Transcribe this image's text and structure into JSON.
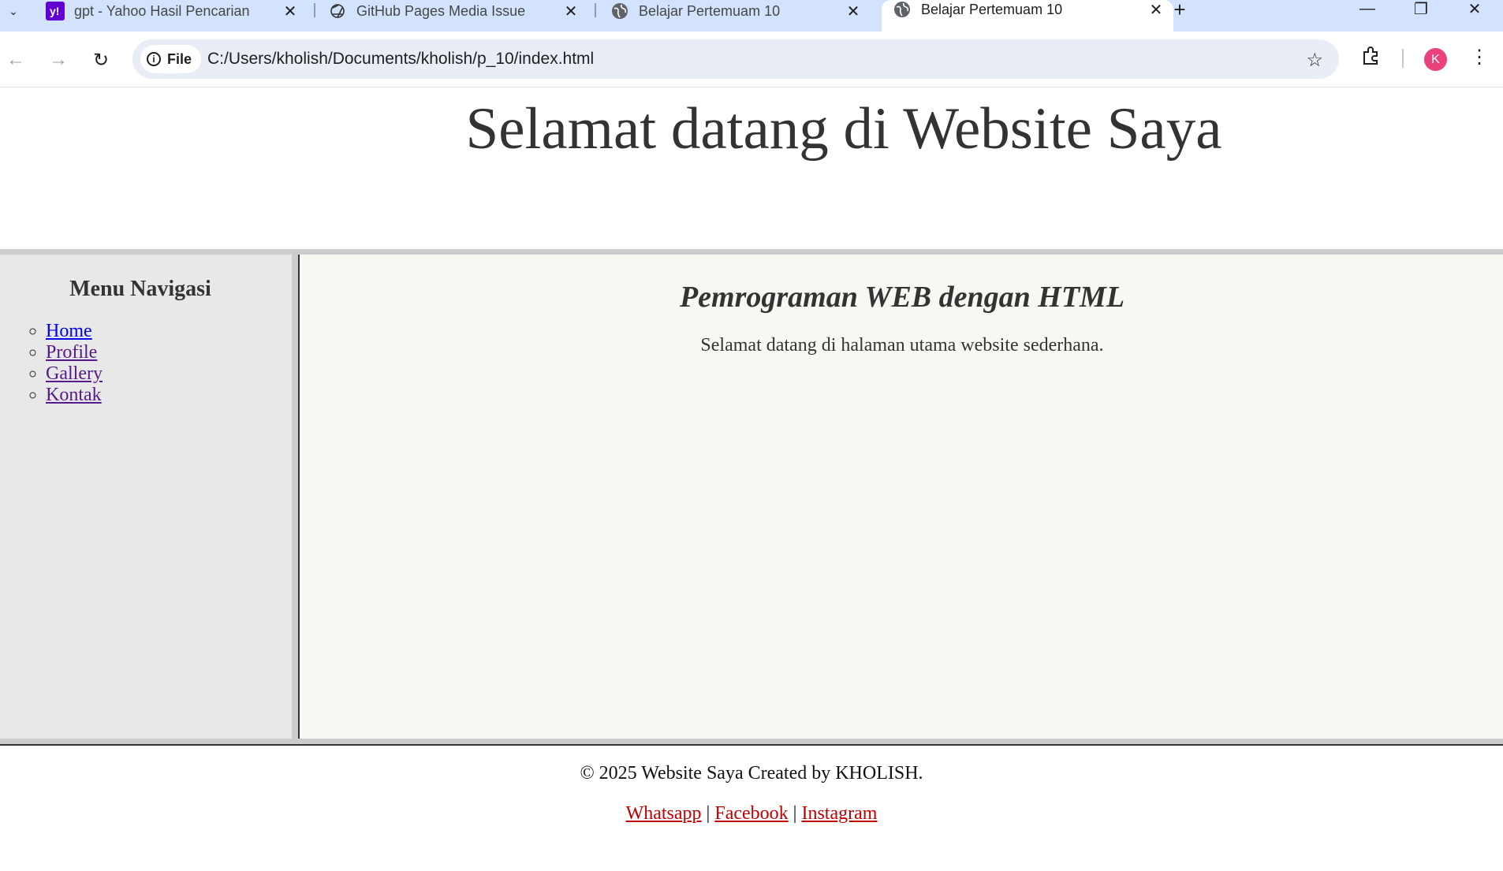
{
  "browser": {
    "tabs": [
      {
        "title": "gpt - Yahoo Hasil Pencarian",
        "favicon": "yahoo-icon",
        "active": false
      },
      {
        "title": "GitHub Pages Media Issue",
        "favicon": "openai-icon",
        "active": false
      },
      {
        "title": "Belajar Pertemuam 10",
        "favicon": "globe-icon",
        "active": false
      },
      {
        "title": "Belajar Pertemuam 10",
        "favicon": "globe-icon",
        "active": true
      }
    ],
    "address": {
      "chip_label": "File",
      "url": "C:/Users/kholish/Documents/kholish/p_10/index.html"
    },
    "profile_initial": "K",
    "colors": {
      "tabstrip": "#d3e3fd",
      "avatar": "#e8417b"
    }
  },
  "page": {
    "header_title": "Selamat datang di Website Saya",
    "sidebar": {
      "heading": "Menu Navigasi",
      "links": [
        "Home",
        "Profile",
        "Gallery",
        "Kontak"
      ]
    },
    "main": {
      "heading": "Pemrograman WEB dengan HTML",
      "text": "Selamat datang di halaman utama website sederhana."
    },
    "footer": {
      "copyright": "© 2025 Website Saya Created by KHOLISH.",
      "links": [
        "Whatsapp",
        "Facebook",
        "Instagram"
      ],
      "separator": "|"
    }
  }
}
